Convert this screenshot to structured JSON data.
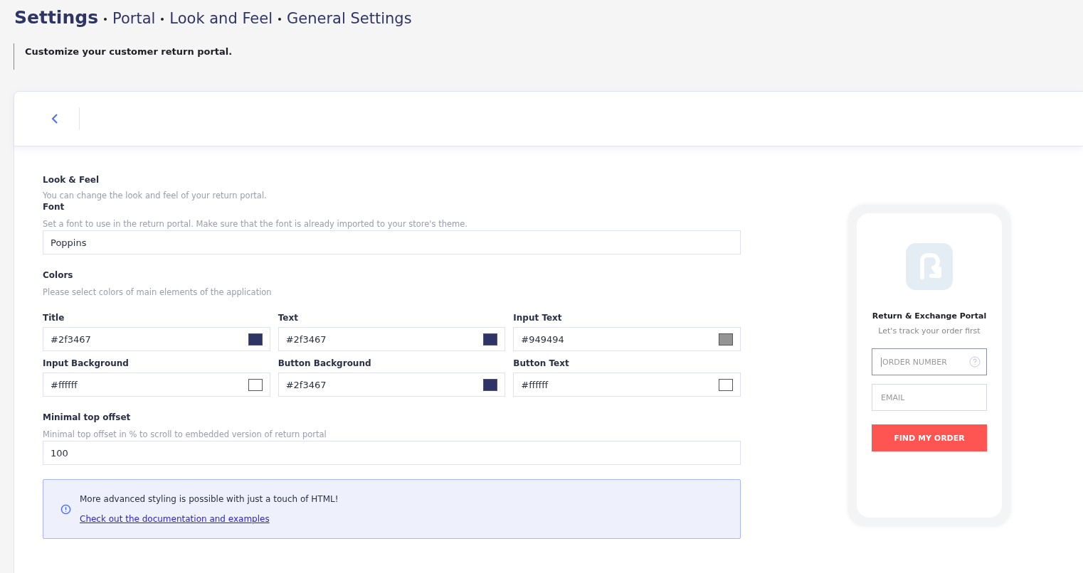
{
  "breadcrumb": {
    "title": "Settings",
    "path": [
      "Portal",
      "Look and Feel",
      "General Settings"
    ]
  },
  "subtitle": "Customize your customer return portal.",
  "look_feel": {
    "heading": "Look & Feel",
    "description": "You can change the look and feel of your return portal."
  },
  "font": {
    "label": "Font",
    "description": "Set a font to use in the return portal. Make sure that the font is already imported to your store's theme.",
    "value": "Poppins"
  },
  "colors": {
    "heading": "Colors",
    "description": "Please select colors of main elements of the application",
    "fields": [
      {
        "label": "Title",
        "value": "#2f3467",
        "color": "#2f3467"
      },
      {
        "label": "Text",
        "value": "#2f3467",
        "color": "#2f3467"
      },
      {
        "label": "Input Text",
        "value": "#949494",
        "color": "#949494"
      },
      {
        "label": "Input Background",
        "value": "#ffffff",
        "color": "#ffffff"
      },
      {
        "label": "Button Background",
        "value": "#2f3467",
        "color": "#2f3467"
      },
      {
        "label": "Button Text",
        "value": "#ffffff",
        "color": "#ffffff"
      }
    ]
  },
  "offset": {
    "label": "Minimal top offset",
    "description": "Minimal top offset in % to scroll to embedded version of return portal",
    "value": "100"
  },
  "info": {
    "text": "More advanced styling is possible with just a touch of HTML!",
    "link": "Check out the documentation and examples"
  },
  "preview": {
    "title": "Return & Exchange Portal",
    "subtitle": "Let's track your order first",
    "order_placeholder": "ORDER NUMBER",
    "email_placeholder": "EMAIL",
    "button": "FIND MY ORDER"
  }
}
